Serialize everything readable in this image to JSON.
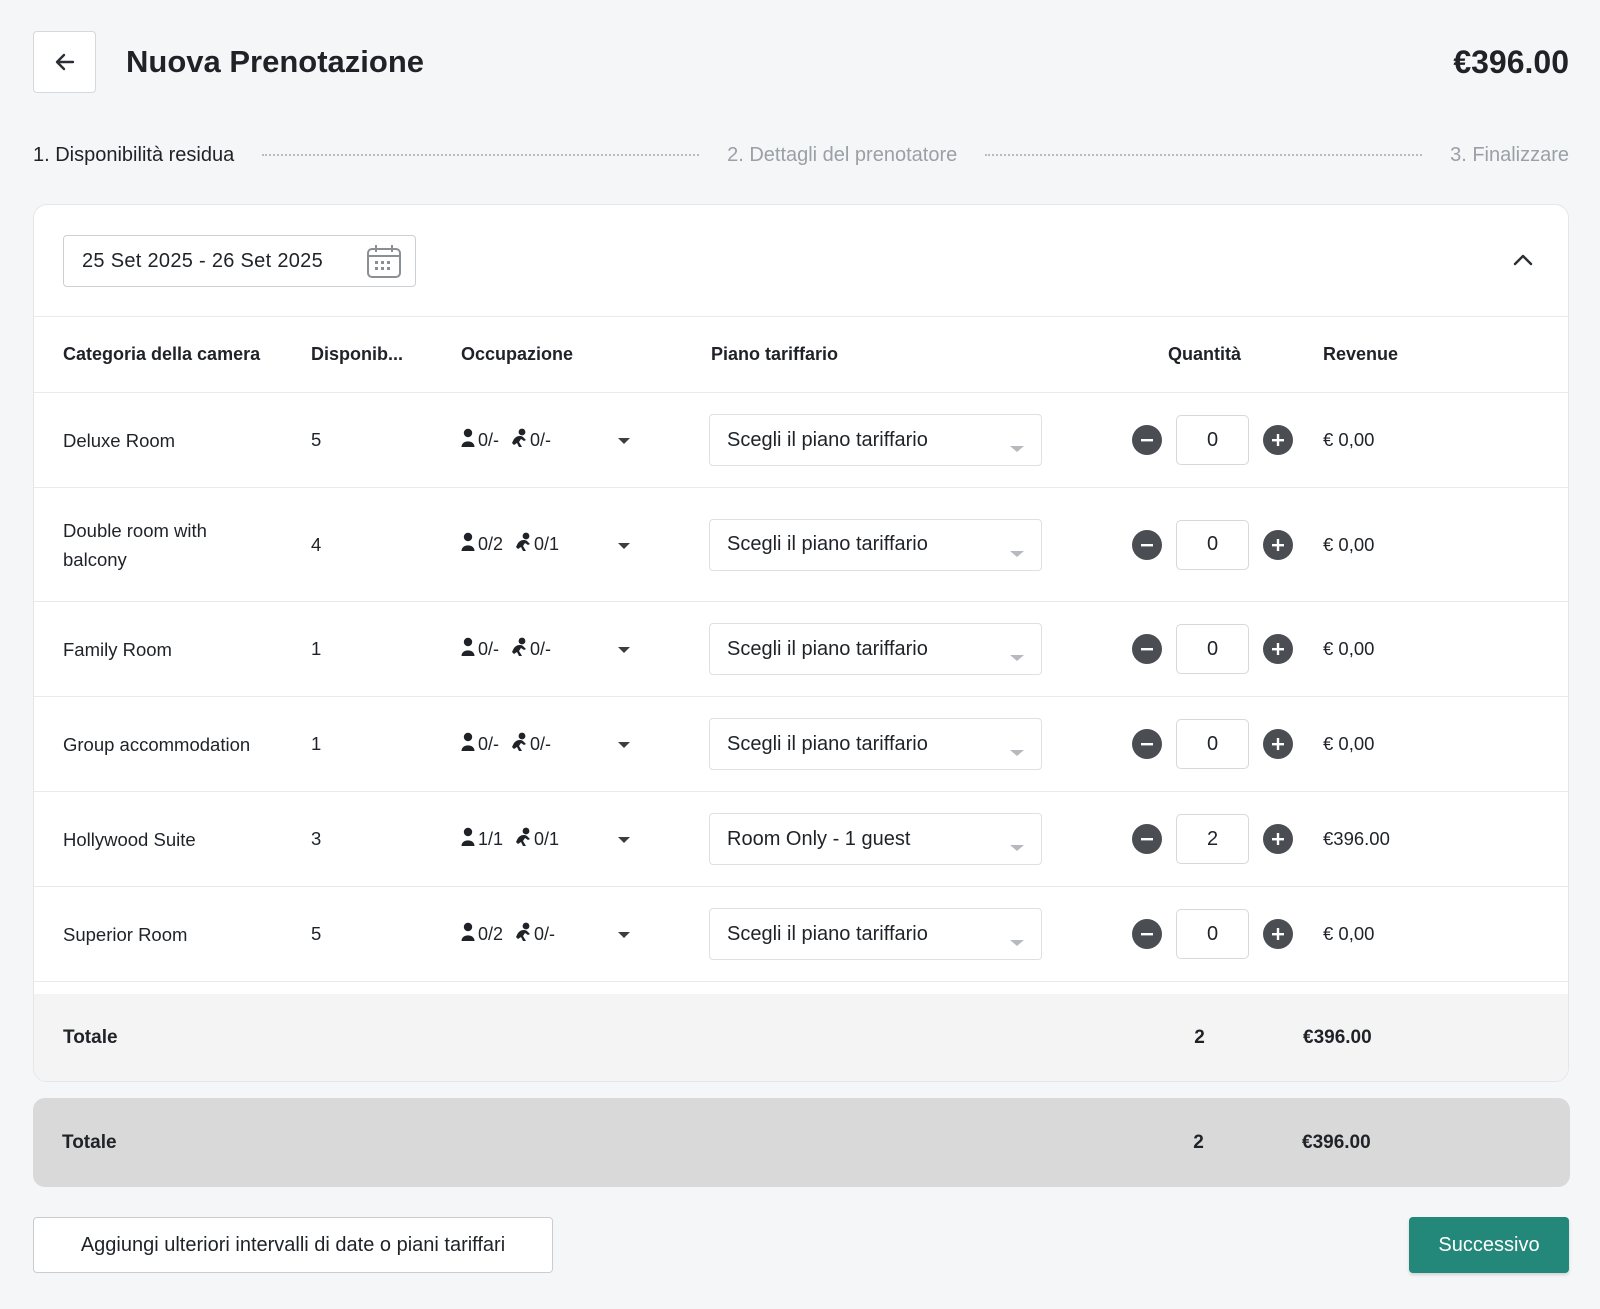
{
  "header": {
    "title": "Nuova Prenotazione",
    "total_price": "€396.00"
  },
  "steps": [
    {
      "label": "1. Disponibilità residua",
      "active": true
    },
    {
      "label": "2. Dettagli del prenotatore",
      "active": false
    },
    {
      "label": "3. Finalizzare",
      "active": false
    }
  ],
  "date_range": "25 Set 2025 - 26 Set 2025",
  "columns": {
    "category": "Categoria della camera",
    "availability": "Disponib...",
    "occupancy": "Occupazione",
    "rate_plan": "Piano tariffario",
    "quantity": "Quantità",
    "revenue": "Revenue"
  },
  "rows": [
    {
      "category": "Deluxe Room",
      "availability": "5",
      "adults": "0/-",
      "children": "0/-",
      "rate_plan": "Scegli il piano tariffario",
      "quantity": "0",
      "revenue": "€ 0,00"
    },
    {
      "category": "Double room with balcony",
      "availability": "4",
      "adults": "0/2",
      "children": "0/1",
      "rate_plan": "Scegli il piano tariffario",
      "quantity": "0",
      "revenue": "€ 0,00"
    },
    {
      "category": "Family Room",
      "availability": "1",
      "adults": "0/-",
      "children": "0/-",
      "rate_plan": "Scegli il piano tariffario",
      "quantity": "0",
      "revenue": "€ 0,00"
    },
    {
      "category": "Group accommodation",
      "availability": "1",
      "adults": "0/-",
      "children": "0/-",
      "rate_plan": "Scegli il piano tariffario",
      "quantity": "0",
      "revenue": "€ 0,00"
    },
    {
      "category": "Hollywood Suite",
      "availability": "3",
      "adults": "1/1",
      "children": "0/1",
      "rate_plan": "Room Only - 1 guest",
      "quantity": "2",
      "revenue": "€396.00"
    },
    {
      "category": "Superior Room",
      "availability": "5",
      "adults": "0/2",
      "children": "0/-",
      "rate_plan": "Scegli il piano tariffario",
      "quantity": "0",
      "revenue": "€ 0,00"
    }
  ],
  "subtotal": {
    "label": "Totale",
    "quantity": "2",
    "revenue": "€396.00"
  },
  "grand_total": {
    "label": "Totale",
    "quantity": "2",
    "revenue": "€396.00"
  },
  "actions": {
    "add_label": "Aggiungi ulteriori intervalli di date o piani tariffari",
    "next_label": "Successivo"
  },
  "colors": {
    "primary": "#23877a",
    "background": "#f5f6f8",
    "total_bg": "#d9d9d9"
  }
}
